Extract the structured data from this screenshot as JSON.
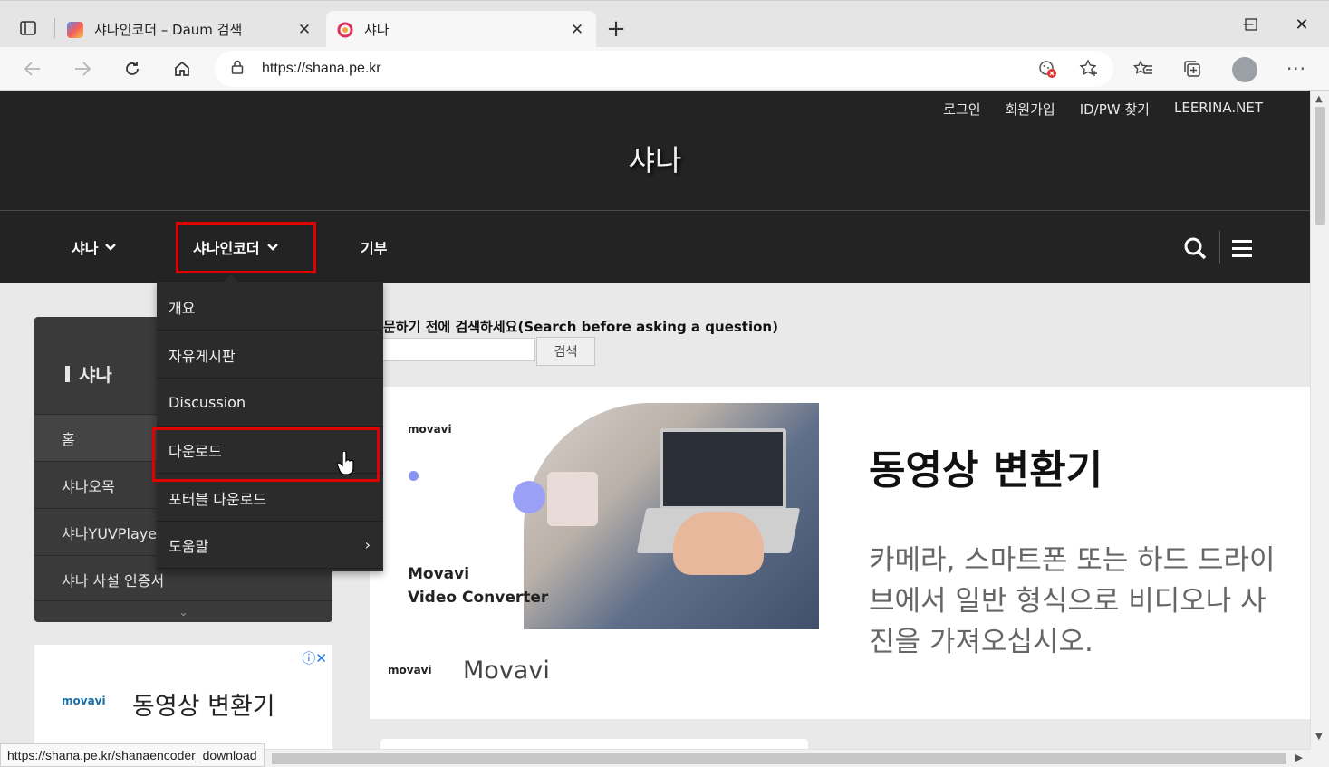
{
  "browser": {
    "tabs": [
      {
        "title": "샤나인코더 – Daum 검색",
        "favicon": "daum-favicon",
        "close": "✕"
      },
      {
        "title": "샤나",
        "favicon": "shana-favicon",
        "close": "✕"
      }
    ],
    "new_tab": "+",
    "window": {
      "minimize": "─",
      "maximize": "☐",
      "close": "✕"
    },
    "url": "https://shana.pe.kr",
    "status_url": "https://shana.pe.kr/shanaencoder_download"
  },
  "site": {
    "title": "샤나",
    "toplinks": [
      "로그인",
      "회원가입",
      "ID/PW 찾기",
      "LEERINA.NET"
    ],
    "nav": [
      {
        "label": "샤나",
        "chevron": "⌄"
      },
      {
        "label": "샤나인코더",
        "chevron": "⌄"
      },
      {
        "label": "기부"
      }
    ]
  },
  "dropdown": {
    "items": [
      "개요",
      "자유게시판",
      "Discussion",
      "다운로드",
      "포터블 다운로드",
      "도움말"
    ],
    "submenu_arrow": "›"
  },
  "sidebar": {
    "title": "샤나",
    "items": [
      "홈",
      "샤나오목",
      "샤나YUVPlayer",
      "샤나 사설 인증서"
    ],
    "more": "⌄"
  },
  "side_ad": {
    "brand": "movavi",
    "text": "동영상 변환기",
    "info": "ⓘ✕"
  },
  "search": {
    "label": "문하기 전에 검색하세요(Search before asking a question)",
    "button": "검색"
  },
  "ad": {
    "logo": "movavi",
    "product_line1": "Movavi",
    "product_line2": "Video Converter",
    "bottom_brand": "movavi",
    "bottom_name": "Movavi",
    "headline": "동영상 변환기",
    "body": "카메라, 스마트폰 또는 하드 드라이브에서 일반 형식으로 비디오나 사진을 가져오십시오."
  },
  "colors": {
    "header_bg": "#232323",
    "highlight": "#e00000",
    "dropdown_bg": "#2b2b2b"
  }
}
